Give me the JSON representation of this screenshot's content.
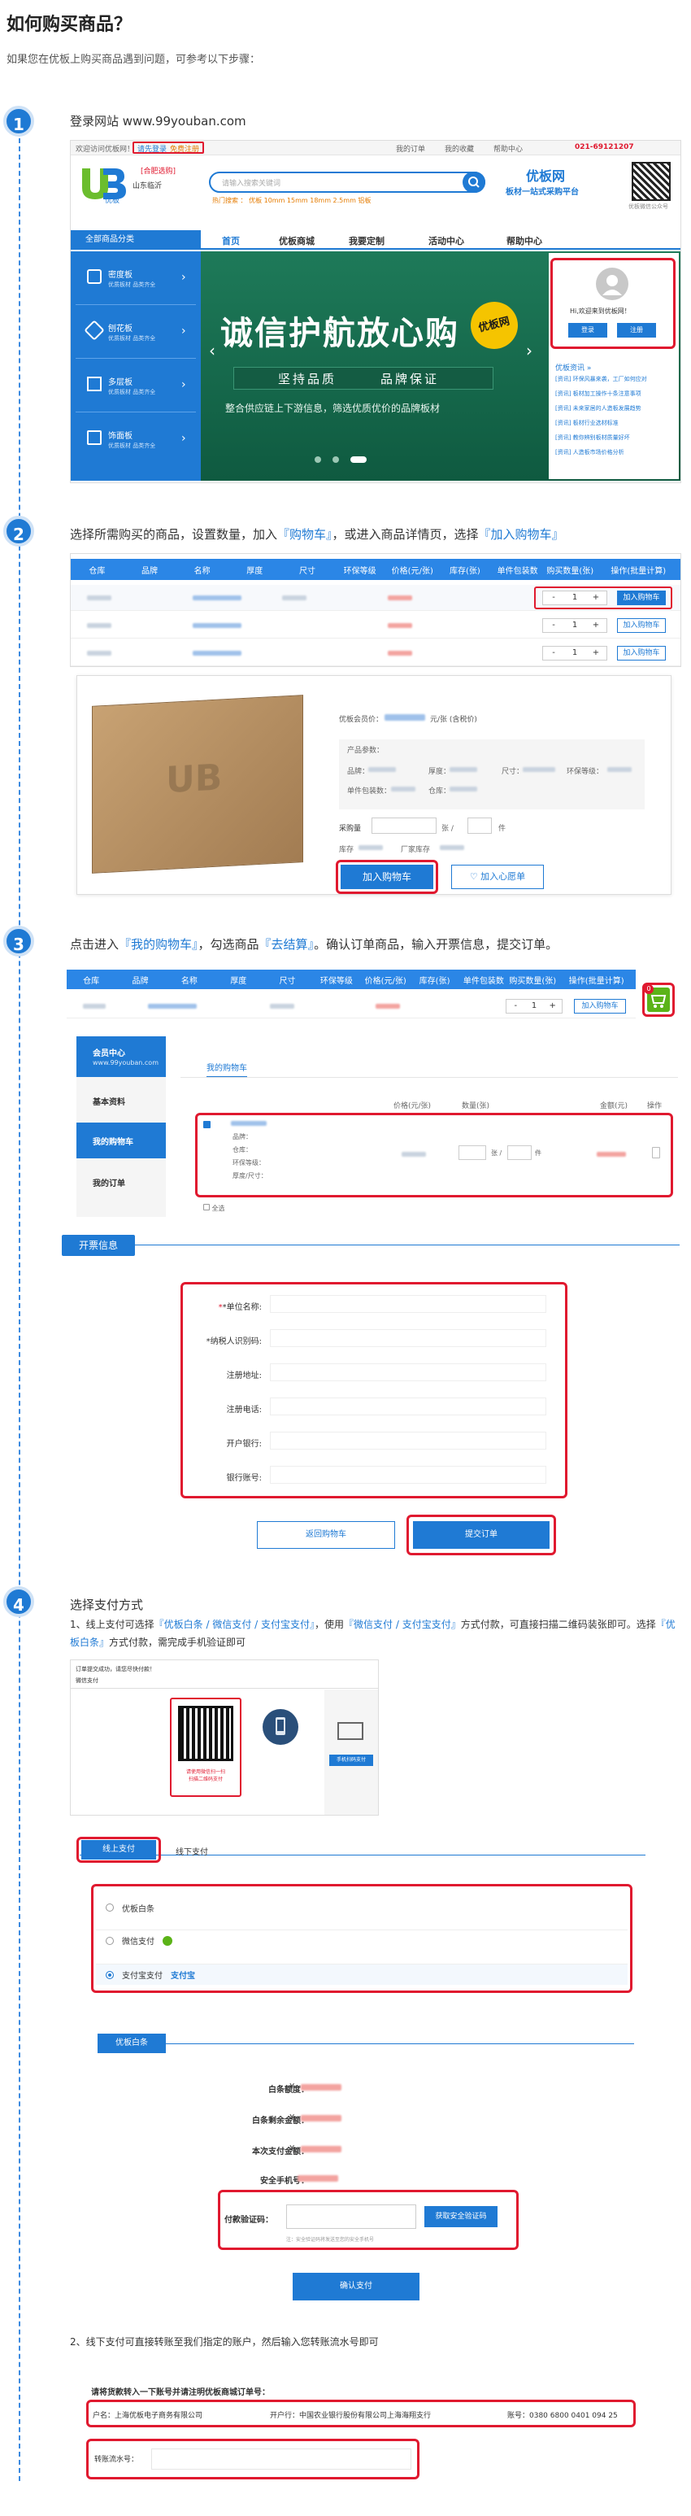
{
  "header": {
    "title": "如何购买商品？",
    "subtitle": "如果您在优板上购买商品遇到问题，可参考以下步骤："
  },
  "steps": [
    {
      "num": "1",
      "title": "登录网站 www.99youban.com"
    },
    {
      "num": "2",
      "title_parts": [
        "选择所需购买的商品，设置数量，加入",
        "『购物车』",
        "，或进入商品详情页，选择",
        "『加入购物车』"
      ]
    },
    {
      "num": "3",
      "title_parts": [
        "点击进入",
        "『我的购物车』",
        "，勾选商品",
        "『去结算』",
        "。确认订单商品，输入开票信息，提交订单。"
      ]
    },
    {
      "num": "4",
      "title": "选择支付方式"
    }
  ],
  "step1": {
    "topbar_welcome": "欢迎访问优板网！",
    "topbar_login": "请先登录",
    "topbar_register": "免费注册",
    "topbar_links": [
      "我的订单",
      "我的收藏",
      "帮助中心"
    ],
    "topbar_phone": "021-69121207",
    "logo_text": "优板",
    "location": "山东临沂",
    "location_badge": "[合肥选购]",
    "search_placeholder": "请输入搜索关键词",
    "hot_search": "热门搜索 ： 优板 10mm 15mm 18mm 2.5mm 铝板",
    "brand_title": "优板网",
    "brand_slogan": "板材一站式采购平台",
    "qr_caption": "优板微信公众号",
    "nav_all": "全部商品分类",
    "nav_items": [
      "首页",
      "优板商城",
      "我要定制",
      "活动中心",
      "帮助中心"
    ],
    "categories": [
      {
        "name": "密度板",
        "sub": "优质板材 品类齐全"
      },
      {
        "name": "刨花板",
        "sub": "优质板材 品类齐全"
      },
      {
        "name": "多层板",
        "sub": "优质板材 品类齐全"
      },
      {
        "name": "饰面板",
        "sub": "优质板材 品类齐全"
      }
    ],
    "hero_title": "诚信护航放心购",
    "hero_badge": "优板网",
    "hero_slogan_1": "坚持品质",
    "hero_slogan_2": "品牌保证",
    "hero_desc": "整合供应链上下游信息，筛选优质优价的品牌板材",
    "greeting": "Hi,欢迎来到优板网！",
    "login_btn": "登录",
    "register_btn": "注册",
    "news_title": "优板资讯 »",
    "news_items": [
      "[资讯] 环保风暴来袭，工厂如何应对",
      "[资讯] 板材加工操作十条注意事项",
      "[资讯] 未来家居的人造板发展趋势",
      "[资讯] 板材行业选材标准",
      "[资讯] 教你辨别板材质量好坏",
      "[资讯] 人造板市场价格分析"
    ]
  },
  "step2": {
    "table_headers": [
      "仓库",
      "品牌",
      "名称",
      "厚度",
      "尺寸",
      "环保等级",
      "价格(元/张)",
      "库存(张)",
      "单件包装数",
      "购买数量(张)",
      "操作(批量计算)"
    ],
    "qty": "1",
    "add_cart_label": "加入购物车",
    "detail_price_label": "优板会员价：",
    "detail_price_unit": "元/张 (含税价)",
    "detail_params_label": "产品参数：",
    "detail_brand": "品牌：",
    "detail_thickness": "厚度：",
    "detail_size": "尺寸：",
    "detail_grade": "环保等级：",
    "detail_pack": "单件包装数：",
    "detail_store": "仓库：",
    "detail_buy_label": "采购量",
    "detail_unit_1": "张 /",
    "detail_unit_2": "件",
    "detail_stock_label": "库存",
    "detail_factory_label": "厂家库存",
    "detail_add_cart": "加入购物车",
    "detail_fav": "加入心愿单"
  },
  "step3": {
    "table_headers": [
      "仓库",
      "品牌",
      "名称",
      "厚度",
      "尺寸",
      "环保等级",
      "价格(元/张)",
      "库存(张)",
      "单件包装数",
      "购买数量(张)",
      "操作(批量计算)"
    ],
    "qty": "1",
    "add_cart_label": "加入购物车",
    "cart_badge": "0",
    "member_center": "会员中心",
    "member_url": "www.99youban.com",
    "side_items": [
      "基本资料",
      "我的购物车",
      "我的订单"
    ],
    "cart_tab": "我的购物车",
    "cart_cols": [
      "价格(元/张)",
      "数量(张)",
      "金额(元)",
      "操作"
    ],
    "item_brand": "品牌：",
    "item_store": "仓库：",
    "item_grade": "环保等级：",
    "item_thickness": "厚度/尺寸：",
    "qty_units": [
      "张 /",
      "件"
    ],
    "check_all": "全选",
    "invoice_tab": "开票信息",
    "invoice_fields": [
      "*单位名称:",
      "*纳税人识别码:",
      "注册地址:",
      "注册电话:",
      "开户银行:",
      "银行账号:"
    ],
    "back_btn": "返回购物车",
    "submit_btn": "提交订单"
  },
  "step4": {
    "desc_parts": [
      "1、线上支付可选择",
      "『优板白条 / 微信支付 / 支付宝支付』",
      "，使用",
      "『微信支付 / 支付宝支付』",
      "方式付款，可直接扫描二维码装张即可。选择",
      "『优板白条』",
      "方式付款，需完成手机验证即可"
    ],
    "qr_screen_title": "订单提交成功，请您尽快付款！",
    "qr_screen_sub": "微信支付",
    "qr_caption": "请使用微信扫一扫\n扫描二维码支付",
    "qr_side_btn": "手机扫码支付",
    "tab_online": "线上支付",
    "tab_offline": "线下支付",
    "pay_options": [
      "优板白条",
      "微信支付",
      "支付宝支付"
    ],
    "alipay_logo": "支付宝",
    "wechat_logo": "微信",
    "credit_tab": "优板白条",
    "credit_fields": [
      "白条额度：",
      "白条剩余金额：",
      "本次支付金额：",
      "安全手机号："
    ],
    "currency": "¥",
    "verify_label": "付款验证码：",
    "verify_btn": "获取安全验证码",
    "verify_hint": "注：安全验证码将发送至您的安全手机号",
    "confirm_btn": "确认支付",
    "offline_desc": "2、线下支付可直接转账至我们指定的账户，然后输入您转账流水号即可",
    "offline_title": "请将货款转入一下账号并请注明优板商城订单号：",
    "account_name": "户名：上海优板电子商务有限公司",
    "bank_name": "开户行：中国农业银行股份有限公司上海海翔支行",
    "account_no": "账号：0380 6800 0401 094 25",
    "serial_label": "转账流水号："
  },
  "colors": {
    "primary": "#1f7ad4",
    "red": "#e0192f",
    "hero": "#1a6b4f",
    "green": "#5bb318"
  }
}
